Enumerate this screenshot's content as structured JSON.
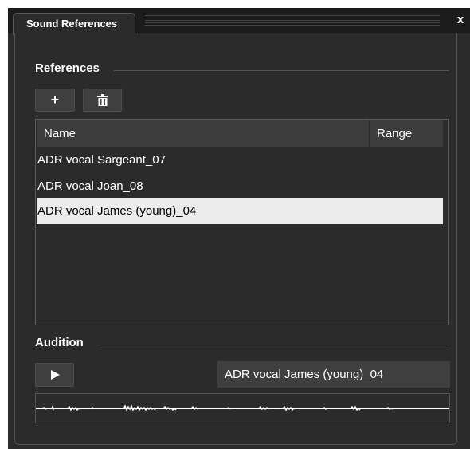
{
  "window": {
    "tab_label": "Sound References",
    "close_label": "x"
  },
  "references": {
    "section_title": "References",
    "add_label": "+",
    "columns": {
      "name": "Name",
      "range": "Range"
    },
    "items": [
      {
        "name": "ADR vocal Sargeant_07",
        "range": ""
      },
      {
        "name": "ADR vocal Joan_08",
        "range": ""
      },
      {
        "name": "ADR vocal James (young)_04",
        "range": "",
        "selected": true
      }
    ]
  },
  "audition": {
    "section_title": "Audition",
    "selected_name": "ADR vocal James (young)_04"
  },
  "colors": {
    "background": "#2b2b2b",
    "selected_row": "#ececec",
    "button": "#3f3f3f"
  }
}
